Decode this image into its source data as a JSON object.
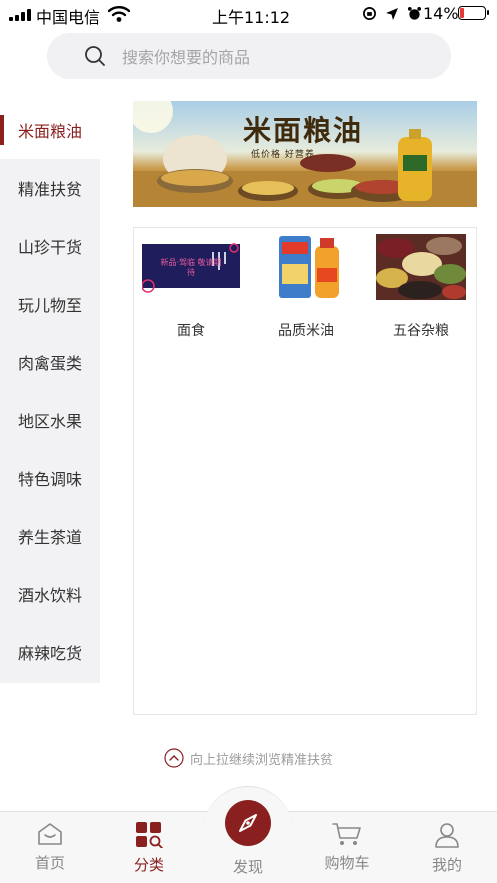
{
  "status_bar": {
    "carrier": "中国电信",
    "time": "上午11:12",
    "battery": "14%"
  },
  "search": {
    "placeholder": "搜索你想要的商品"
  },
  "sidebar": {
    "items": [
      {
        "label": "米面粮油",
        "active": true
      },
      {
        "label": "精准扶贫"
      },
      {
        "label": "山珍干货"
      },
      {
        "label": "玩儿物至"
      },
      {
        "label": "肉禽蛋类"
      },
      {
        "label": "地区水果"
      },
      {
        "label": "特色调味"
      },
      {
        "label": "养生茶道"
      },
      {
        "label": "酒水饮料"
      },
      {
        "label": "麻辣吃货"
      }
    ]
  },
  "banner": {
    "title": "米面粮油",
    "subtitle": "低价格 好营养"
  },
  "products": [
    {
      "name": "面食",
      "image_text": "新品·驾临 敬请期待"
    },
    {
      "name": "品质米油"
    },
    {
      "name": "五谷杂粮"
    }
  ],
  "pull_hint": "向上拉继续浏览精准扶贫",
  "tabs": [
    {
      "label": "首页",
      "icon": "home-icon"
    },
    {
      "label": "分类",
      "icon": "category-icon",
      "active": true
    },
    {
      "label": "发现",
      "icon": "compass-icon"
    },
    {
      "label": "购物车",
      "icon": "cart-icon"
    },
    {
      "label": "我的",
      "icon": "user-icon"
    }
  ],
  "colors": {
    "accent": "#8a1f1f",
    "sidebar_bg": "#f2f2f4",
    "search_bg": "#f1f1f3"
  }
}
